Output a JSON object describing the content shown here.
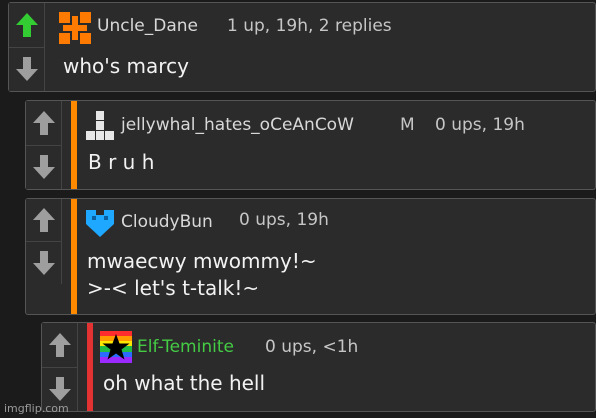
{
  "comments": [
    {
      "user": "Uncle_Dane",
      "badge": "",
      "meta": "1 up, 19h, 2 replies",
      "text": "who's marcy",
      "username_color": "#d8d8d8",
      "accent": "none",
      "upvoted": true
    },
    {
      "user": "jellywhal_hates_oCeAnCoW",
      "badge": "M",
      "meta": "0 ups, 19h",
      "text": "B r u h",
      "username_color": "#d8d8d8",
      "accent": "#ff8a00",
      "upvoted": false
    },
    {
      "user": "CloudyBun",
      "badge": "",
      "meta": "0 ups, 19h",
      "text": "mwaecwy mwommy!~\n>-< let's t-talk!~",
      "username_color": "#d8d8d8",
      "accent": "#ff8a00",
      "upvoted": false
    },
    {
      "user": "Elf-Teminite",
      "badge": "",
      "meta": "0 ups, <1h",
      "text": "oh what the hell",
      "username_color": "#44cc44",
      "accent": "#e23232",
      "upvoted": false
    }
  ],
  "icons": {
    "upvote": "arrow-up-icon",
    "downvote": "arrow-down-icon"
  },
  "watermark": "imgflip.com"
}
